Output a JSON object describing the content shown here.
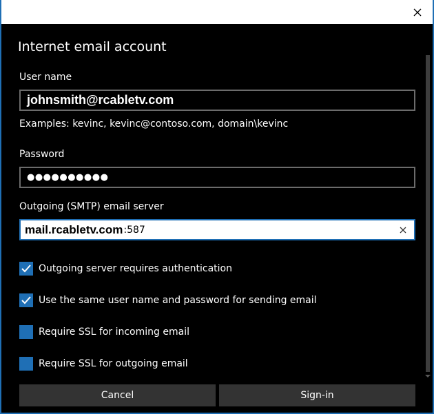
{
  "window": {
    "close_icon": "close-icon"
  },
  "form": {
    "title": "Internet email account",
    "username": {
      "label": "User name",
      "value": "johnsmith@rcabletv.com",
      "hint": "Examples: kevinc, kevinc@contoso.com, domain\\kevinc"
    },
    "password": {
      "label": "Password",
      "masked_value": "●●●●●●●●●●"
    },
    "outgoing_server": {
      "label": "Outgoing (SMTP) email server",
      "host": "mail.rcabletv.com",
      "port": ":587",
      "clear_icon": "clear-icon"
    },
    "options": [
      {
        "label": "Outgoing server requires authentication",
        "checked": true
      },
      {
        "label": "Use the same user name and password for sending email",
        "checked": true
      },
      {
        "label": "Require SSL for incoming email",
        "checked": false
      },
      {
        "label": "Require SSL for outgoing email",
        "checked": false
      }
    ]
  },
  "actions": {
    "cancel": "Cancel",
    "signin": "Sign-in"
  },
  "colors": {
    "accent": "#1f6fb5",
    "background": "#000000",
    "button": "#333333",
    "border": "#6b6b6b"
  }
}
